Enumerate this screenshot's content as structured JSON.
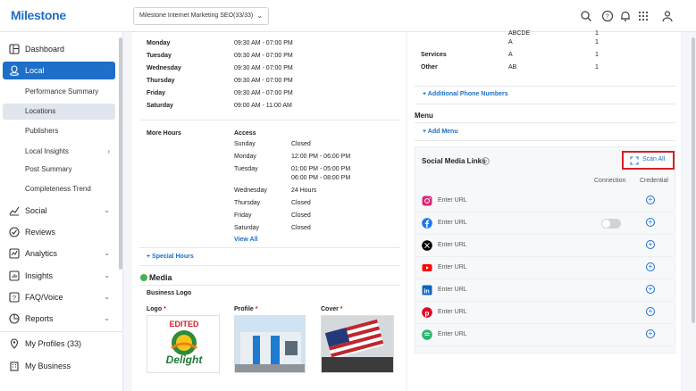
{
  "app": {
    "logo": "Milestone",
    "account_selector": "Milestone Internet Marketing SEO(33/33)"
  },
  "topbar_icons": [
    "search-icon",
    "help-icon",
    "bell-icon",
    "apps-grid-icon",
    "user-icon"
  ],
  "sidebar": {
    "items": [
      {
        "label": "Dashboard",
        "icon": "dashboard-icon"
      },
      {
        "label": "Local",
        "icon": "location-pin-icon",
        "active": true
      },
      {
        "label": "Social",
        "icon": "chart-icon"
      },
      {
        "label": "Reviews",
        "icon": "check-circle-icon"
      },
      {
        "label": "Analytics",
        "icon": "analytics-icon"
      },
      {
        "label": "Insights",
        "icon": "insights-icon"
      },
      {
        "label": "FAQ/Voice",
        "icon": "faq-icon"
      },
      {
        "label": "Reports",
        "icon": "reports-icon"
      },
      {
        "label": "My Profiles (33)",
        "icon": "pin-icon"
      },
      {
        "label": "My Business",
        "icon": "building-icon"
      }
    ],
    "sub_items": [
      {
        "label": "Performance Summary"
      },
      {
        "label": "Locations",
        "selected": true
      },
      {
        "label": "Publishers"
      },
      {
        "label": "Local Insights"
      },
      {
        "label": "Post Summary"
      },
      {
        "label": "Completeness Trend"
      }
    ]
  },
  "hours": {
    "rows": [
      {
        "day": "Monday",
        "time": "09:30 AM - 07:00 PM"
      },
      {
        "day": "Tuesday",
        "time": "09:30 AM - 07:00 PM"
      },
      {
        "day": "Wednesday",
        "time": "09:30 AM - 07:00 PM"
      },
      {
        "day": "Thursday",
        "time": "09:30 AM - 07:00 PM"
      },
      {
        "day": "Friday",
        "time": "09:30 AM - 07:00 PM"
      },
      {
        "day": "Saturday",
        "time": "09:00 AM - 11:00 AM"
      }
    ]
  },
  "more_hours": {
    "label": "More Hours",
    "category": "Access",
    "rows": [
      {
        "day": "Sunday",
        "time": "Closed"
      },
      {
        "day": "Monday",
        "time": "12:00 PM - 06:00 PM"
      },
      {
        "day": "Tuesday",
        "time": "01:00 PM - 05:00 PM",
        "time2": "06:00 PM - 08:00 PM"
      },
      {
        "day": "Wednesday",
        "time": "24 Hours"
      },
      {
        "day": "Thursday",
        "time": "Closed"
      },
      {
        "day": "Friday",
        "time": "Closed"
      },
      {
        "day": "Saturday",
        "time": "Closed"
      }
    ],
    "view_all": "View All"
  },
  "special_hours_link": "+ Special Hours",
  "media": {
    "title": "Media",
    "subtitle": "Business Logo",
    "logo_label": "Logo",
    "profile_label": "Profile",
    "cover_label": "Cover",
    "required_mark": "*",
    "logo_text_top": "EDITED",
    "logo_text_main": "Delight"
  },
  "phones": {
    "rows": [
      {
        "label": "",
        "value": "ABCDE",
        "count": "1"
      },
      {
        "label": "",
        "value": "A",
        "count": "1"
      },
      {
        "label": "Services",
        "value": "A",
        "count": "1"
      },
      {
        "label": "Other",
        "value": "AB",
        "count": "1"
      }
    ],
    "add_link": "+ Additional Phone Numbers"
  },
  "menu": {
    "title": "Menu",
    "add_link": "+ Add Menu"
  },
  "social": {
    "title": "Social Media Links",
    "scan_all": "Scan All",
    "col_connection": "Connection",
    "col_credential": "Credential",
    "placeholder": "Enter URL",
    "rows": [
      {
        "network": "instagram-icon",
        "color": "#d62976"
      },
      {
        "network": "facebook-icon",
        "color": "#1877f2",
        "toggle": true
      },
      {
        "network": "x-icon",
        "color": "#000000"
      },
      {
        "network": "youtube-icon",
        "color": "#ff0000"
      },
      {
        "network": "linkedin-icon",
        "color": "#0a66c2"
      },
      {
        "network": "pinterest-icon",
        "color": "#e60023"
      },
      {
        "network": "other-icon",
        "color": "#2bb673"
      }
    ]
  }
}
